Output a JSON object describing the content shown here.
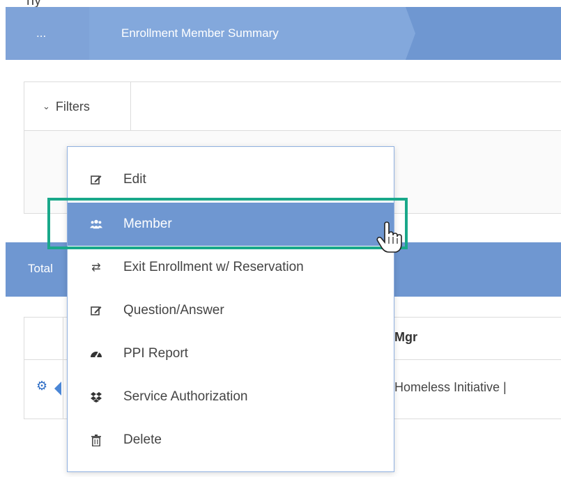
{
  "top_partial": "ny",
  "breadcrumb": {
    "ellipsis": "...",
    "current": "Enrollment Member Summary"
  },
  "filters": {
    "label": "Filters"
  },
  "table": {
    "total_label": "Total",
    "header_mgr": "Mgr",
    "row1_initiative": "Homeless Initiative |"
  },
  "menu": {
    "items": [
      {
        "label": "Edit",
        "icon": "edit-icon"
      },
      {
        "label": "Member",
        "icon": "users-icon"
      },
      {
        "label": "Exit Enrollment w/ Reservation",
        "icon": "exchange-icon"
      },
      {
        "label": "Question/Answer",
        "icon": "edit-icon"
      },
      {
        "label": "PPI Report",
        "icon": "dashboard-icon"
      },
      {
        "label": "Service Authorization",
        "icon": "dropbox-icon"
      },
      {
        "label": "Delete",
        "icon": "trash-icon"
      }
    ],
    "active_index": 1
  },
  "colors": {
    "accent_blue": "#6f97d1",
    "highlight_green": "#19a88a",
    "gear_blue": "#2c6cc4"
  }
}
